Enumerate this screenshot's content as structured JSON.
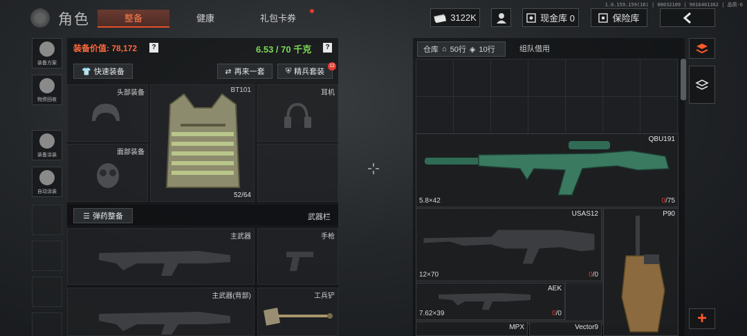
{
  "version": "1.0.159.159(16) | 08032109 | 9016401362 | 品质-6",
  "header": {
    "title": "角色",
    "tabs": [
      {
        "label": "整备",
        "active": true
      },
      {
        "label": "健康",
        "active": false
      },
      {
        "label": "礼包卡券",
        "active": false
      }
    ],
    "currency": "3122K",
    "cash_label": "现金库 0",
    "insurance_label": "保险库"
  },
  "rail": [
    {
      "label": "装备方案"
    },
    {
      "label": "物资回收"
    },
    {
      "label": "装备涂装"
    },
    {
      "label": "自动涂装"
    }
  ],
  "equipment": {
    "value_label": "装备价值: 78,172",
    "weight_label": "6.53 / 70 千克",
    "quick_equip": "快速装备",
    "again": "再来一套",
    "elite": "精兵套装",
    "elite_badge": "12",
    "slots": {
      "head": "头部装备",
      "vest": "BT101",
      "vest_count": "52/64",
      "headset": "耳机",
      "face": "面部装备"
    },
    "ammo_btn": "弹药整备",
    "weapon_bar": "武器栏",
    "primary": "主武器",
    "pistol": "手枪",
    "primary_back": "主武器(背部)",
    "shovel": "工兵铲"
  },
  "warehouse": {
    "tab_label": "仓库",
    "rows1": "50行",
    "rows2": "10行",
    "team_loan": "组队借用",
    "items": [
      {
        "name": "QBU191",
        "caliber": "5.8×42",
        "ammo_cur": "0",
        "ammo_max": "/75"
      },
      {
        "name": "USAS12",
        "caliber": "12×70",
        "ammo_cur": "0",
        "ammo_max": "/0"
      },
      {
        "name": "P90",
        "caliber": "",
        "ammo_cur": "",
        "ammo_max": ""
      },
      {
        "name": "AEK",
        "caliber": "7.62×39",
        "ammo_cur": "0",
        "ammo_max": "/0"
      },
      {
        "name": "MPX",
        "caliber": "",
        "ammo_cur": "",
        "ammo_max": ""
      },
      {
        "name": "Vector9",
        "caliber": "",
        "ammo_cur": "",
        "ammo_max": ""
      }
    ],
    "add_label": "+"
  }
}
